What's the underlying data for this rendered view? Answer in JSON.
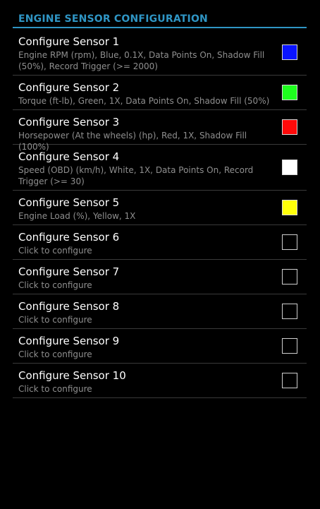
{
  "header": {
    "title": "ENGINE SENSOR CONFIGURATION",
    "accent_color": "#2f95c4"
  },
  "sensors": [
    {
      "title": "Configure Sensor 1",
      "subtitle": "Engine RPM (rpm), Blue, 0.1X, Data Points On, Shadow Fill (50%), Record Trigger (>= 2000)",
      "color": "#0a14ff"
    },
    {
      "title": "Configure Sensor 2",
      "subtitle": "Torque (ft-lb), Green, 1X, Data Points On, Shadow Fill (50%)",
      "color": "#1eff1e"
    },
    {
      "title": "Configure Sensor 3",
      "subtitle": "Horsepower (At the wheels) (hp), Red, 1X, Shadow Fill (100%)",
      "color": "#ff0a0a"
    },
    {
      "title": "Configure Sensor 4",
      "subtitle": "Speed (OBD) (km/h), White, 1X, Data Points On, Record Trigger (>= 30)",
      "color": "#ffffff"
    },
    {
      "title": "Configure Sensor 5",
      "subtitle": "Engine Load (%), Yellow, 1X",
      "color": "#ffff0a"
    },
    {
      "title": "Configure Sensor 6",
      "subtitle": "Click to configure",
      "color": ""
    },
    {
      "title": "Configure Sensor 7",
      "subtitle": "Click to configure",
      "color": ""
    },
    {
      "title": "Configure Sensor 8",
      "subtitle": "Click to configure",
      "color": ""
    },
    {
      "title": "Configure Sensor 9",
      "subtitle": "Click to configure",
      "color": ""
    },
    {
      "title": "Configure Sensor 10",
      "subtitle": "Click to configure",
      "color": ""
    }
  ]
}
